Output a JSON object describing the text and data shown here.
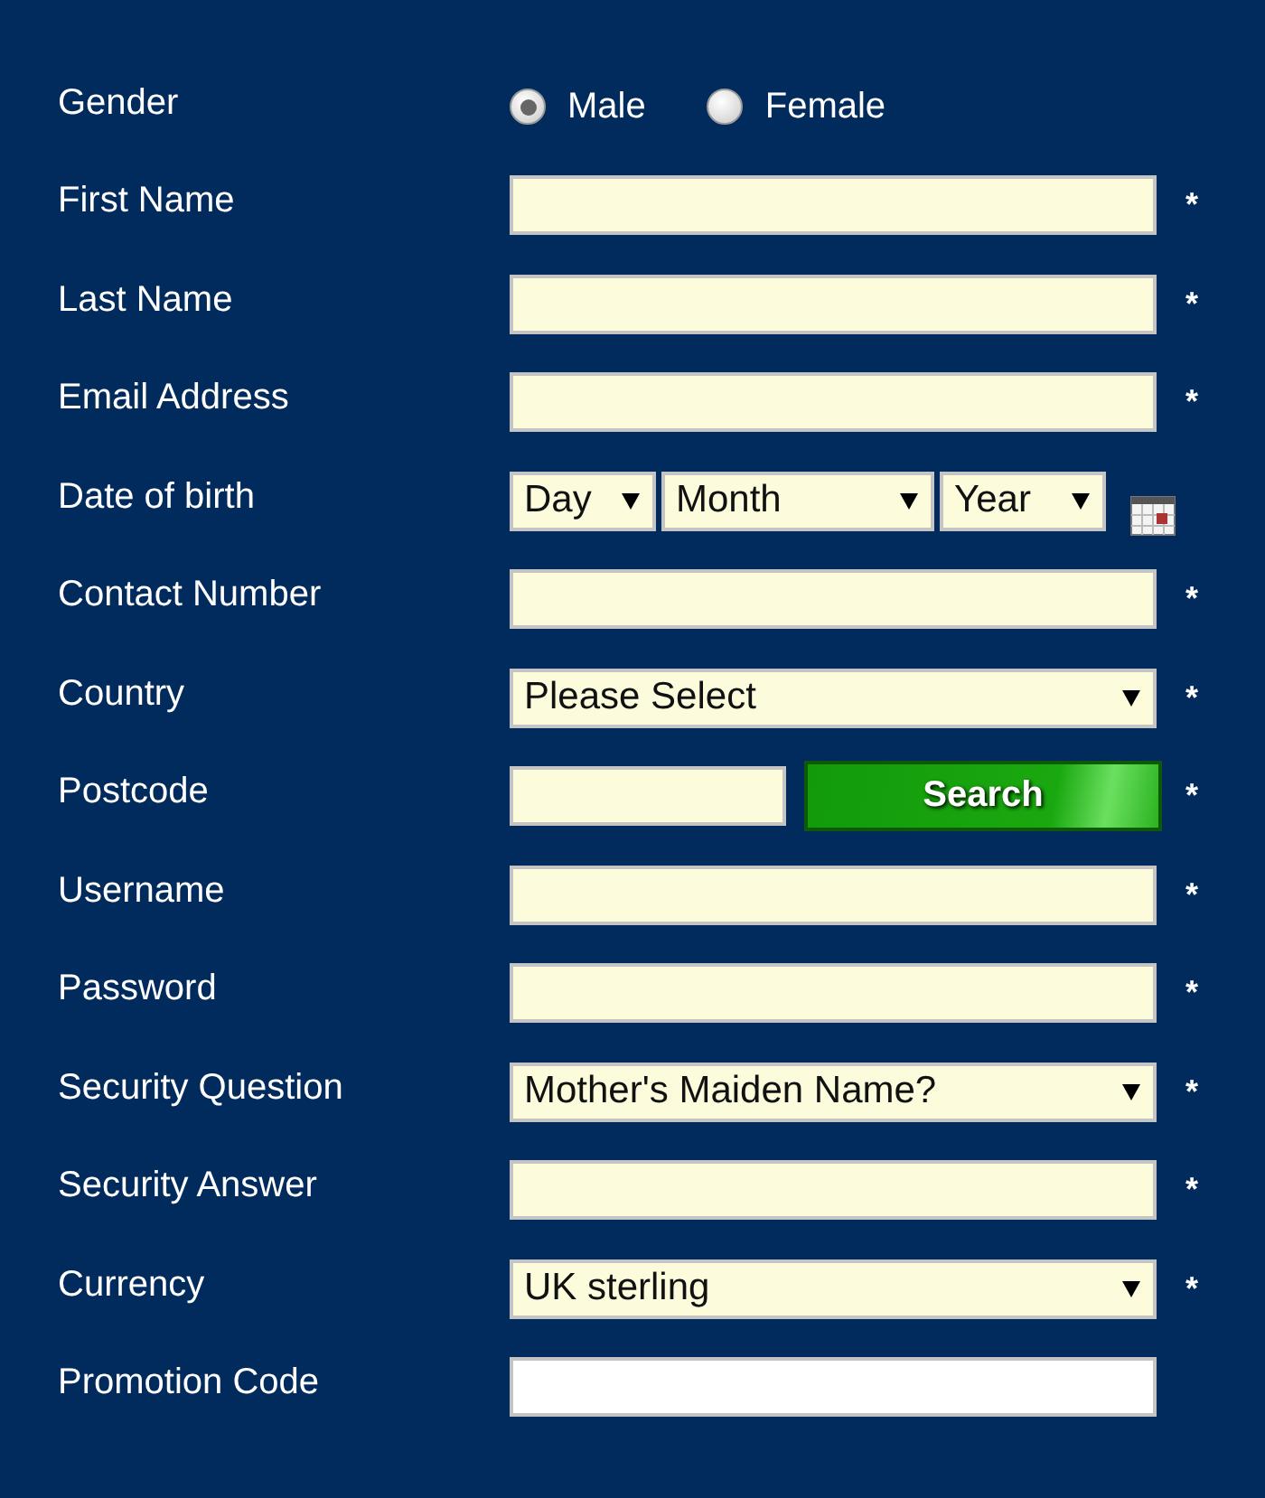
{
  "form": {
    "rows": [
      {
        "kind": "radio",
        "label": "Gender",
        "options": [
          {
            "label": "Male",
            "selected": true
          },
          {
            "label": "Female",
            "selected": false
          }
        ]
      },
      {
        "kind": "text",
        "label": "First Name",
        "required": true,
        "mark": "*"
      },
      {
        "kind": "text",
        "label": "Last Name",
        "required": true,
        "mark": "*"
      },
      {
        "kind": "text",
        "label": "Email Address",
        "required": true,
        "mark": "*"
      },
      {
        "kind": "date",
        "label": "Date of birth",
        "selects": [
          "Day",
          "Month",
          "Year"
        ]
      },
      {
        "kind": "text",
        "label": "Contact Number",
        "required": true,
        "mark": "*"
      },
      {
        "kind": "select",
        "label": "Country",
        "value": "Please Select",
        "mark": "*"
      },
      {
        "kind": "postcode",
        "label": "Postcode",
        "button": "Search",
        "mark": "*"
      },
      {
        "kind": "text",
        "label": "Username",
        "required": true,
        "mark": "*"
      },
      {
        "kind": "text",
        "label": "Password",
        "required": true,
        "mark": "*"
      },
      {
        "kind": "select",
        "label": "Security Question",
        "value": "Mother's Maiden Name?",
        "mark": "*"
      },
      {
        "kind": "text",
        "label": "Security Answer",
        "required": true,
        "mark": "*"
      },
      {
        "kind": "select",
        "label": "Currency",
        "value": "UK sterling",
        "mark": "*"
      },
      {
        "kind": "text",
        "label": "Promotion Code",
        "required": false
      }
    ]
  }
}
